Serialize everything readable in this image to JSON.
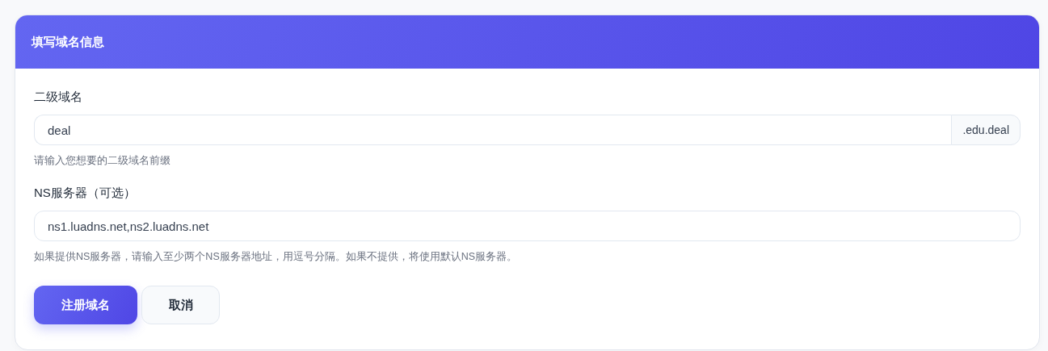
{
  "card": {
    "title": "填写域名信息"
  },
  "fields": [
    {
      "label": "二级域名",
      "value": "deal",
      "suffix": ".edu.deal",
      "hint": "请输入您想要的二级域名前缀"
    },
    {
      "label": "NS服务器（可选）",
      "value": "ns1.luadns.net,ns2.luadns.net",
      "hint": "如果提供NS服务器，请输入至少两个NS服务器地址，用逗号分隔。如果不提供，将使用默认NS服务器。"
    }
  ],
  "buttons": [
    {
      "label": "注册域名",
      "kind": "primary"
    },
    {
      "label": "取消",
      "kind": "secondary"
    }
  ]
}
